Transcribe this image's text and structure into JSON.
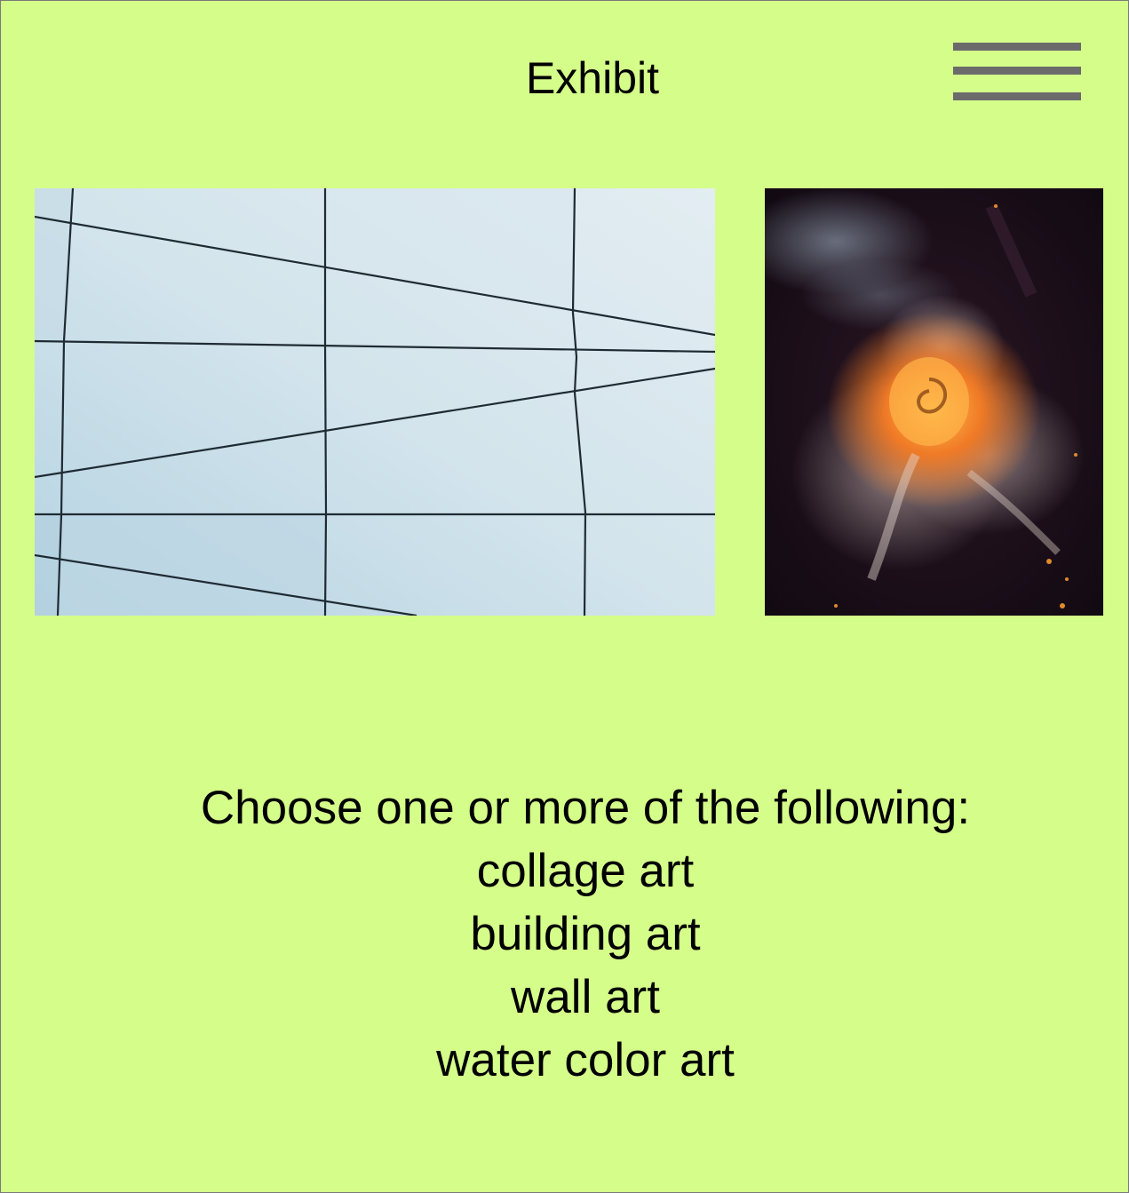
{
  "header": {
    "title": "Exhibit",
    "menu_icon": "hamburger-menu-icon"
  },
  "gallery": {
    "items": [
      {
        "name": "geometric-glass-facade",
        "colors": [
          "#cfe1ea",
          "#1d2a33"
        ]
      },
      {
        "name": "abstract-fluid-nebula",
        "colors": [
          "#1a0e1a",
          "#f08a2a"
        ]
      }
    ]
  },
  "selection": {
    "prompt": "Choose one or more of the following:",
    "options": [
      {
        "label": "collage art"
      },
      {
        "label": "building art"
      },
      {
        "label": "wall art"
      },
      {
        "label": "water color art"
      }
    ]
  },
  "colors": {
    "background": "#d5fd8a",
    "menu_bars": "#6b6b6b",
    "text": "#000000"
  }
}
